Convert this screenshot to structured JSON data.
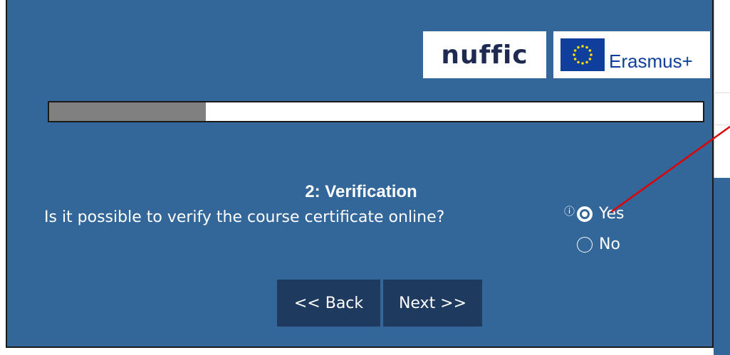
{
  "logos": {
    "nuffic": "nuffic",
    "erasmus": "Erasmus+"
  },
  "progress": {
    "percent": 24
  },
  "step": {
    "title": "2: Verification"
  },
  "question": {
    "text": "Is it possible to verify the course certificate online?",
    "info_glyph": "ⓘ",
    "options": [
      {
        "label": "Yes",
        "selected": true
      },
      {
        "label": "No",
        "selected": false
      }
    ]
  },
  "navigation": {
    "back_label": "<< Back",
    "next_label": "Next >>"
  },
  "colors": {
    "panel_bg": "#336699",
    "button_bg": "#1f3a5f",
    "progress_fill": "#808080",
    "annotation_arrow": "#e00000"
  }
}
